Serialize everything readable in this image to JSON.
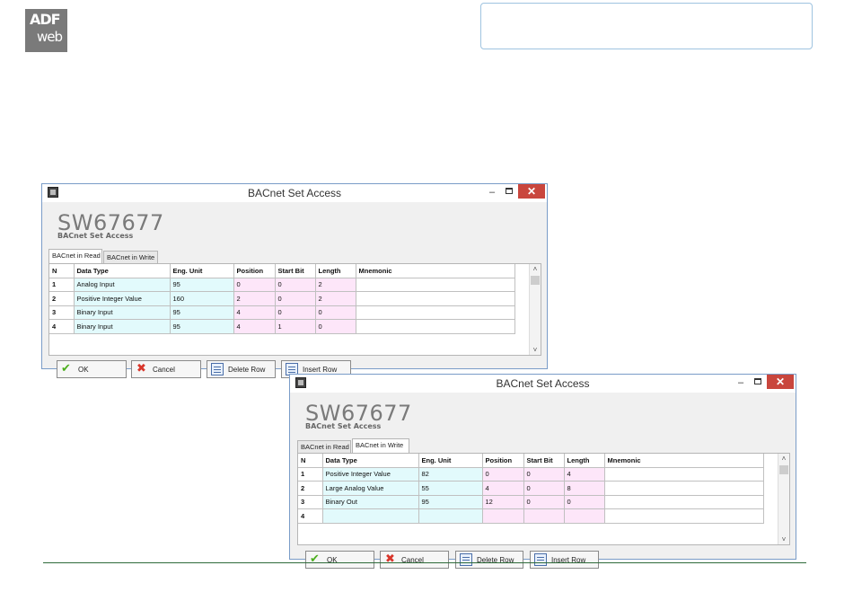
{
  "logo": {
    "line1": "ADF",
    "line2": "web"
  },
  "colors": {
    "cyan_cell": "#e2fafc",
    "pink_cell": "#fde6f9",
    "close_button": "#c9463d",
    "window_border": "#7a9cc8"
  },
  "windows": [
    {
      "title": "BACnet Set Access",
      "product": "SW67677",
      "subtitle": "BACnet Set Access",
      "tabs": [
        {
          "label": "BACnet in Read",
          "active": true
        },
        {
          "label": "BACnet in Write",
          "active": false
        }
      ],
      "columns": [
        "N",
        "Data Type",
        "Eng. Unit",
        "Position",
        "Start Bit",
        "Length",
        "Mnemonic"
      ],
      "rows": [
        [
          "1",
          "Analog Input",
          "95",
          "0",
          "0",
          "2",
          ""
        ],
        [
          "2",
          "Positive Integer Value",
          "160",
          "2",
          "0",
          "2",
          ""
        ],
        [
          "3",
          "Binary Input",
          "95",
          "4",
          "0",
          "0",
          ""
        ],
        [
          "4",
          "Binary Input",
          "95",
          "4",
          "1",
          "0",
          ""
        ]
      ],
      "buttons": {
        "ok": "OK",
        "cancel": "Cancel",
        "delete": "Delete Row",
        "insert": "Insert Row"
      }
    },
    {
      "title": "BACnet Set Access",
      "product": "SW67677",
      "subtitle": "BACnet Set Access",
      "tabs": [
        {
          "label": "BACnet in Read",
          "active": false
        },
        {
          "label": "BACnet in Write",
          "active": true
        }
      ],
      "columns": [
        "N",
        "Data Type",
        "Eng. Unit",
        "Position",
        "Start Bit",
        "Length",
        "Mnemonic"
      ],
      "rows": [
        [
          "1",
          "Positive Integer Value",
          "82",
          "0",
          "0",
          "4",
          ""
        ],
        [
          "2",
          "Large Analog Value",
          "55",
          "4",
          "0",
          "8",
          ""
        ],
        [
          "3",
          "Binary Out",
          "95",
          "12",
          "0",
          "0",
          ""
        ],
        [
          "4",
          "",
          "",
          "",
          "",
          "",
          ""
        ]
      ],
      "buttons": {
        "ok": "OK",
        "cancel": "Cancel",
        "delete": "Delete Row",
        "insert": "Insert Row"
      }
    }
  ]
}
